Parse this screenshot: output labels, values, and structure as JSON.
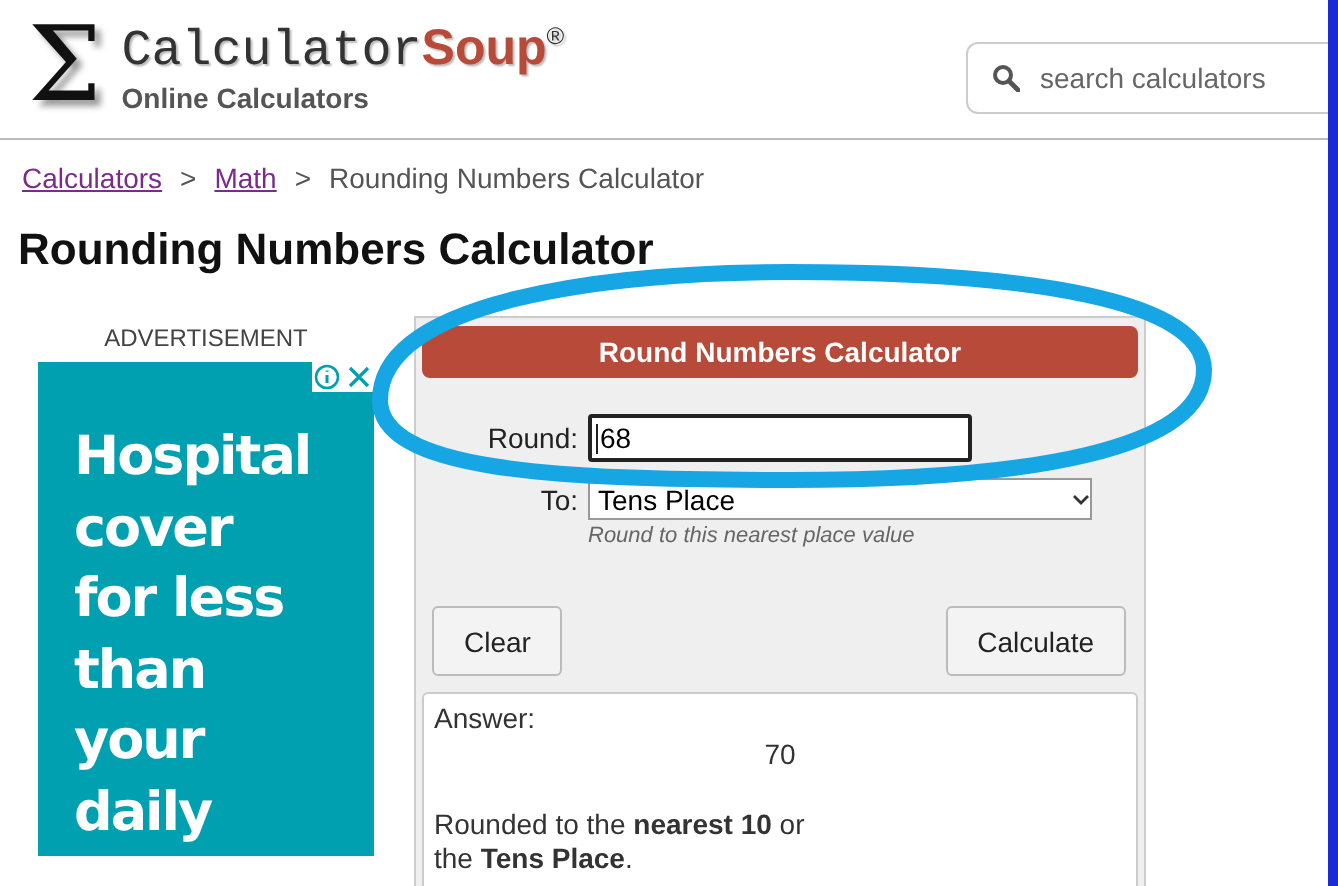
{
  "header": {
    "logo_name": "Calculator",
    "logo_accent": "Soup",
    "logo_mark": "®",
    "logo_symbol": "Σ",
    "tagline": "Online Calculators",
    "search": {
      "placeholder": "search calculators"
    }
  },
  "breadcrumb": {
    "links": [
      "Calculators",
      "Math"
    ],
    "separator": ">",
    "current": "Rounding Numbers Calculator"
  },
  "page_title": "Rounding Numbers Calculator",
  "advertisement": {
    "label": "ADVERTISEMENT",
    "lines": [
      "Hospital",
      "cover",
      "for less",
      "than",
      "your",
      "daily"
    ]
  },
  "calculator": {
    "title": "Round Numbers Calculator",
    "fields": [
      {
        "kind": "input",
        "label": "Round:",
        "value": "68"
      },
      {
        "kind": "select",
        "label": "To:",
        "value": "Tens Place",
        "hint": "Round to this nearest place value"
      }
    ],
    "buttons": [
      "Clear",
      "Calculate"
    ],
    "answer": {
      "label": "Answer:",
      "value": "70",
      "explanation": "Rounded to the **nearest 10** or\nthe **Tens Place**."
    }
  },
  "annotation": {
    "kind": "ellipse",
    "color": "#16a6e4"
  }
}
